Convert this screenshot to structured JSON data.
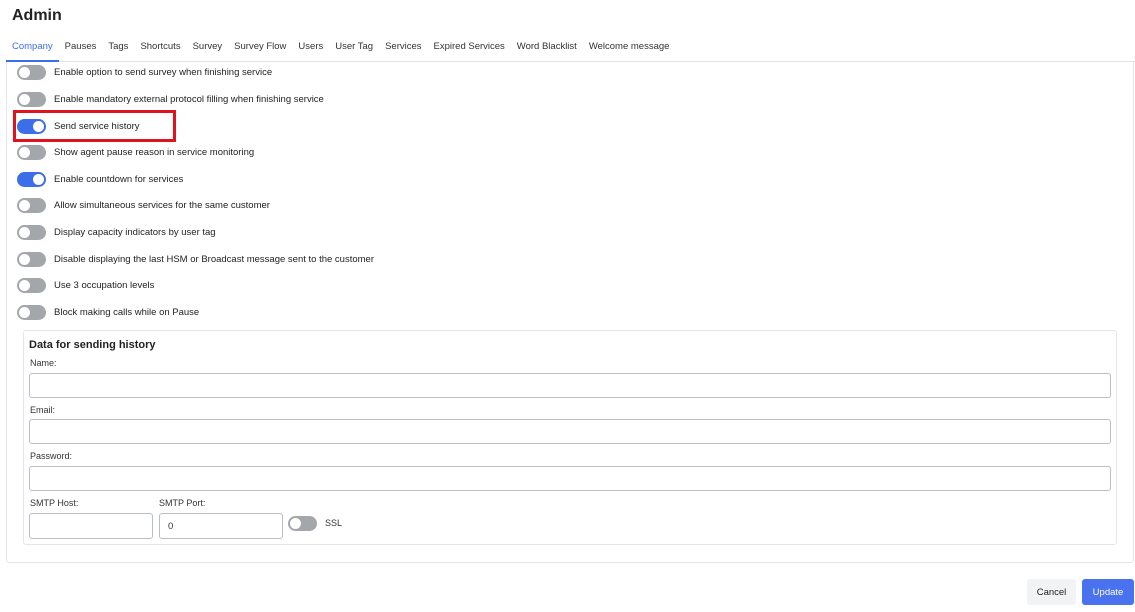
{
  "page": {
    "title": "Admin"
  },
  "tabs": [
    {
      "label": "Company",
      "active": true
    },
    {
      "label": "Pauses"
    },
    {
      "label": "Tags"
    },
    {
      "label": "Shortcuts"
    },
    {
      "label": "Survey"
    },
    {
      "label": "Survey Flow"
    },
    {
      "label": "Users"
    },
    {
      "label": "User Tag"
    },
    {
      "label": "Services"
    },
    {
      "label": "Expired Services"
    },
    {
      "label": "Word Blacklist"
    },
    {
      "label": "Welcome message"
    }
  ],
  "settings": {
    "toggles": [
      {
        "label": "Enable option to send survey when finishing service",
        "checked": false
      },
      {
        "label": "Enable mandatory external protocol filling when finishing service",
        "checked": false
      },
      {
        "label": "Send service history",
        "checked": true
      },
      {
        "label": "Show agent pause reason in service monitoring",
        "checked": false
      },
      {
        "label": "Enable countdown for services",
        "checked": true
      },
      {
        "label": "Allow simultaneous services for the same customer",
        "checked": false
      },
      {
        "label": "Display capacity indicators by user tag",
        "checked": false
      },
      {
        "label": "Disable displaying the last HSM or Broadcast message sent to the customer",
        "checked": false
      },
      {
        "label": "Use 3 occupation levels",
        "checked": false
      },
      {
        "label": "Block making calls while on Pause",
        "checked": false
      }
    ]
  },
  "history_panel": {
    "title": "Data for sending history",
    "name_label": "Name:",
    "name_value": "",
    "email_label": "Email:",
    "email_value": "",
    "password_label": "Password:",
    "password_value": "",
    "smtp_host_label": "SMTP Host:",
    "smtp_host_value": "",
    "smtp_port_label": "SMTP Port:",
    "smtp_port_value": "0",
    "ssl_label": "SSL",
    "ssl_checked": false
  },
  "footer": {
    "cancel_label": "Cancel",
    "update_label": "Update"
  },
  "colors": {
    "accent": "#3b6ee8",
    "toggle_off": "#a3a6ab",
    "highlight": "#e0141e",
    "update_button": "#4a72ee"
  }
}
